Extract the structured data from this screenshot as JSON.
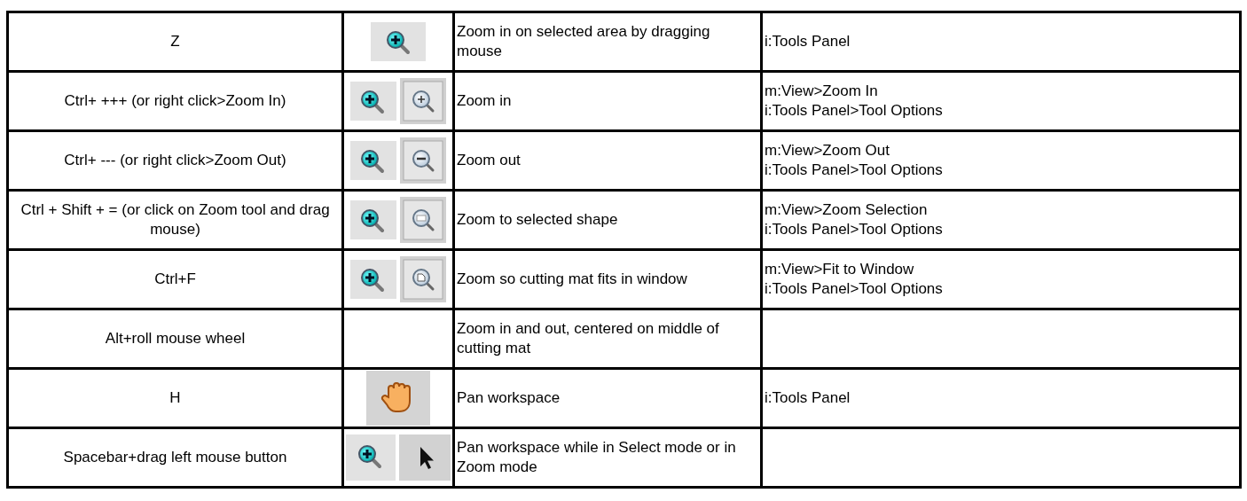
{
  "table": {
    "rows": [
      {
        "column_1": "Z",
        "column_3": "Zoom in on selected area by dragging mouse",
        "column_4": [
          "i:Tools Panel"
        ]
      },
      {
        "column_1": "Ctrl+ +++ (or right click>Zoom In)",
        "column_3": "Zoom in",
        "column_4": [
          "m:View>Zoom In",
          "i:Tools Panel>Tool Options"
        ]
      },
      {
        "column_1": "Ctrl+ ---  (or right click>Zoom Out)",
        "column_3": "Zoom out",
        "column_4": [
          "m:View>Zoom Out",
          "i:Tools Panel>Tool Options"
        ]
      },
      {
        "column_1": "Ctrl + Shift + = (or click on Zoom tool and drag mouse)",
        "column_3": "Zoom to selected shape",
        "column_4": [
          "m:View>Zoom Selection",
          "i:Tools Panel>Tool Options"
        ]
      },
      {
        "column_1": "Ctrl+F",
        "column_3": "Zoom so cutting mat fits in window",
        "column_4": [
          "m:View>Fit to Window",
          "i:Tools Panel>Tool Options"
        ]
      },
      {
        "column_1": "Alt+roll mouse wheel",
        "column_3": "Zoom in and out, centered on middle of cutting mat",
        "column_4": []
      },
      {
        "column_1": "H",
        "column_3": "Pan workspace",
        "column_4": [
          "i:Tools Panel"
        ]
      },
      {
        "column_1": "Spacebar+drag left mouse button",
        "column_3": "Pan workspace while in Select mode or in Zoom mode",
        "column_4": []
      }
    ]
  }
}
